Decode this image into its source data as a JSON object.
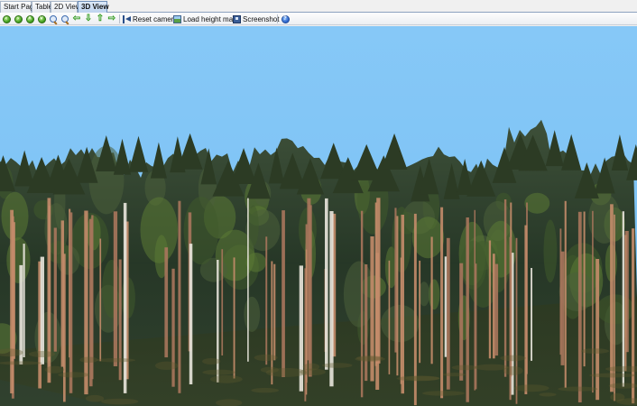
{
  "tabs": [
    {
      "label": "Start Page",
      "active": false
    },
    {
      "label": "Table",
      "active": false
    },
    {
      "label": "2D View",
      "active": false
    },
    {
      "label": "3D View",
      "active": true
    }
  ],
  "toolbar": {
    "nav_icons": [
      "navigate-left-icon",
      "navigate-right-icon",
      "navigate-up-icon",
      "navigate-down-icon"
    ],
    "zoom_icons": [
      "zoom-in-icon",
      "zoom-out-icon"
    ],
    "pan_icons": [
      "pan-left-icon",
      "pan-down-icon",
      "pan-up-icon",
      "pan-right-icon"
    ],
    "reset_camera_label": "Reset camera",
    "load_height_map_label": "Load height map",
    "screenshot_label": "Screenshot",
    "help_icon": "help-icon"
  },
  "scene": {
    "sky_color": "#7fc3f5",
    "ground_color": "#b8b468",
    "canopy_color": "#24331f",
    "trunk_color": "#c08a6a"
  }
}
